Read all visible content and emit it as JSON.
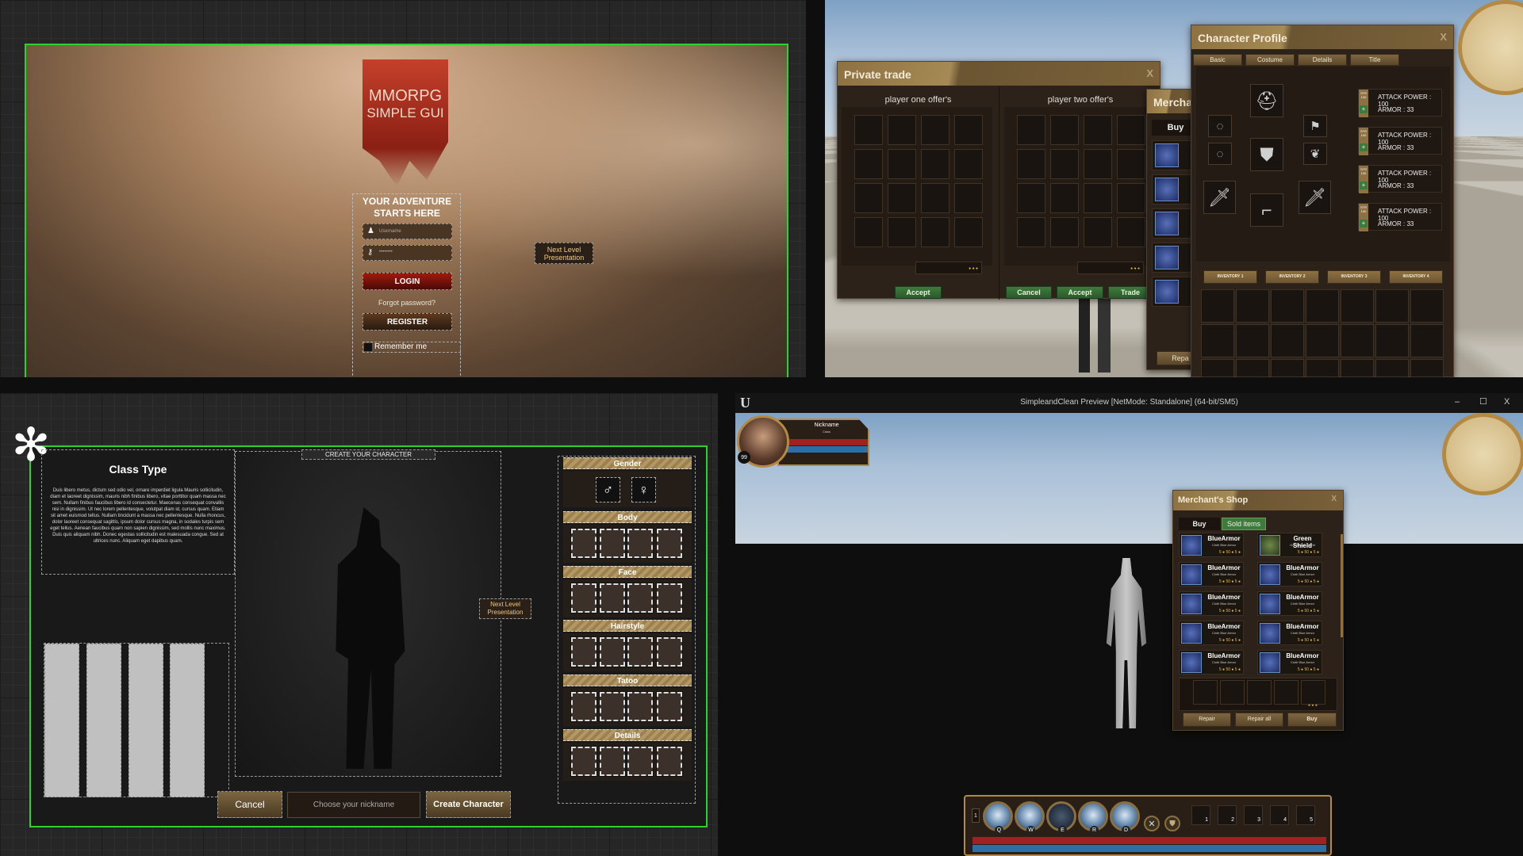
{
  "login": {
    "logo_line1": "MMORPG",
    "logo_line2": "SIMPLE GUI",
    "title": "YOUR ADVENTURE STARTS HERE",
    "username_placeholder": "Username",
    "password_placeholder": "••••••••",
    "login_label": "LOGIN",
    "forgot_label": "Forgot password?",
    "register_label": "REGISTER",
    "remember_label": "Remember me",
    "next_level": "Next Level Presentation"
  },
  "trade": {
    "title": "Private trade",
    "close": "X",
    "player_one": "player one offer's",
    "player_two": "player two offer's",
    "accept_label": "Accept",
    "cancel_label": "Cancel",
    "trade_label": "Trade",
    "coins": "● ● ●"
  },
  "merchant_back": {
    "title": "Merchan",
    "buy_tab": "Buy",
    "repair": "Repa"
  },
  "profile": {
    "title": "Character Profile",
    "close": "X",
    "tabs": [
      "Basic",
      "Costume",
      "Details",
      "Title"
    ],
    "stats": [
      {
        "badge": "STR 100",
        "attack": "ATTACK POWER : 100",
        "armor": "ARMOR : 33"
      },
      {
        "badge": "STR 100",
        "attack": "ATTACK POWER : 100",
        "armor": "ARMOR : 33"
      },
      {
        "badge": "STR 100",
        "attack": "ATTACK POWER : 100",
        "armor": "ARMOR : 33"
      },
      {
        "badge": "STR 100",
        "attack": "ATTACK POWER : 100",
        "armor": "ARMOR : 33"
      }
    ],
    "inventory_tabs": [
      "INVENTORY 1",
      "INVENTORY 2",
      "INVENTORY 3",
      "INVENTORY 4"
    ]
  },
  "create": {
    "class_title": "Class Type",
    "class_desc": "Duis libero metus, dictum sed odio vel, ornare imperdiet ligula Mauris sollicitudin, diam et laoreet dignissim, mauris nibh finibus libero, vitae porttitor quam massa nec sem. Nullam finibus faucibus libero id consectetur. Maecenas consequat convallis nisi in dignissim. Ut nec lorem pellentesque, volutpat diam id, cursus quam. Etiam sit amet euismod tellus. Nullam tincidunt a massa nec pellentesque. Nulla rhoncus, dolor laoreet consequat sagittis, ipsum dolor cursus magna, in sodales turpis sem eget tellus. Aenean faucibus quam non sapien dignissim, sed mollis nunc maximus. Duis quis aliquam nibh. Donec egestas sollicitudin est malesuada congue. Sed at ultrices nunc. Aliquam eget dapibus quam.",
    "header": "CREATE YOUR CHARACTER",
    "next_level": "Next Level Presentation",
    "sections": [
      "Gender",
      "Body",
      "Face",
      "Hairstyle",
      "Tatoo",
      "Details"
    ],
    "male": "♂",
    "female": "♀",
    "cancel_label": "Cancel",
    "nickname_placeholder": "Choose your nickname",
    "create_label": "Create Character"
  },
  "preview": {
    "title": "SimpleandClean Preview [NetMode: Standalone]  (64-bit/SM5)",
    "logo": "U",
    "minimize": "–",
    "maximize": "☐",
    "close": "X",
    "nickname": "Nickname",
    "class": "Class",
    "level": "99"
  },
  "shop": {
    "title": "Merchant's Shop",
    "close": "X",
    "tabs": [
      "Buy",
      "Sold items"
    ],
    "items": [
      {
        "name": "BlueArmor",
        "desc": "Cloth Blue Armor",
        "cost": "5 ● 50 ● 5 ●"
      },
      {
        "name": "Green Shield",
        "desc": "Good basic shield",
        "cost": "5 ● 50 ● 5 ●"
      },
      {
        "name": "BlueArmor",
        "desc": "Cloth Blue Armor",
        "cost": "5 ● 50 ● 5 ●"
      },
      {
        "name": "BlueArmor",
        "desc": "Cloth Blue Armor",
        "cost": "5 ● 50 ● 5 ●"
      },
      {
        "name": "BlueArmor",
        "desc": "Cloth Blue Armor",
        "cost": "5 ● 50 ● 5 ●"
      },
      {
        "name": "BlueArmor",
        "desc": "Cloth Blue Armor",
        "cost": "5 ● 50 ● 5 ●"
      },
      {
        "name": "BlueArmor",
        "desc": "Cloth Blue Armor",
        "cost": "5 ● 50 ● 5 ●"
      },
      {
        "name": "BlueArmor",
        "desc": "Cloth Blue Armor",
        "cost": "5 ● 50 ● 5 ●"
      },
      {
        "name": "BlueArmor",
        "desc": "Cloth Blue Armor",
        "cost": "5 ● 50 ● 5 ●"
      },
      {
        "name": "BlueArmor",
        "desc": "Cloth Blue Armor",
        "cost": "5 ● 50 ● 5 ●"
      }
    ],
    "repair_label": "Repair",
    "repair_all_label": "Repair all",
    "buy_label": "Buy",
    "total": "● ● ●"
  },
  "actionbar": {
    "page": "1",
    "skills": [
      "Q",
      "W",
      "E",
      "R",
      "D"
    ],
    "slots": [
      "1",
      "2",
      "3",
      "4",
      "5"
    ]
  },
  "colors": {
    "accent": "#8d7142",
    "editor_selection": "#2fd12f",
    "health": "#a32020",
    "mana": "#2e6ea6",
    "button_green": "#3f7a3d"
  }
}
